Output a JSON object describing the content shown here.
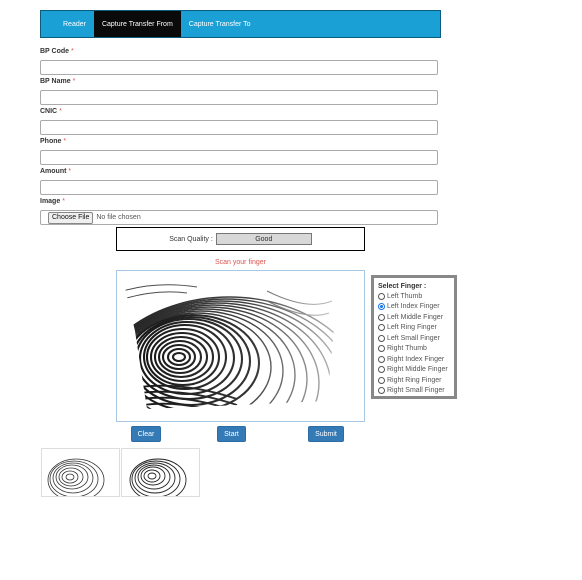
{
  "tabs": [
    {
      "label": "Reader",
      "active": false
    },
    {
      "label": "Capture Transfer From",
      "active": true
    },
    {
      "label": "Capture Transfer To",
      "active": false
    }
  ],
  "form": {
    "required_marker": "*",
    "fields": [
      {
        "label": "BP Code",
        "value": ""
      },
      {
        "label": "BP Name",
        "value": ""
      },
      {
        "label": "CNIC",
        "value": ""
      },
      {
        "label": "Phone",
        "value": ""
      },
      {
        "label": "Amount",
        "value": ""
      }
    ],
    "image": {
      "label": "Image",
      "button": "Choose File",
      "status": "No file chosen"
    }
  },
  "scan": {
    "quality_label": "Scan Quality :",
    "quality_value": "Good",
    "message": "Scan your finger"
  },
  "finger_select": {
    "title": "Select Finger :",
    "options": [
      "Left Thumb",
      "Left Index Finger",
      "Left Middle Finger",
      "Left Ring Finger",
      "Left Small Finger",
      "Right Thumb",
      "Right Index Finger",
      "Right Middle Finger",
      "Right Ring Finger",
      "Right Small Finger"
    ],
    "selected": "Left Index Finger"
  },
  "buttons": {
    "clear": "Clear",
    "start": "Start",
    "submit": "Submit"
  },
  "colors": {
    "tab_bar": "#1ba0d6",
    "tab_active": "#0a0a0a",
    "button": "#337ab7",
    "required": "#d9534f",
    "radio_checked": "#1a73e8"
  }
}
